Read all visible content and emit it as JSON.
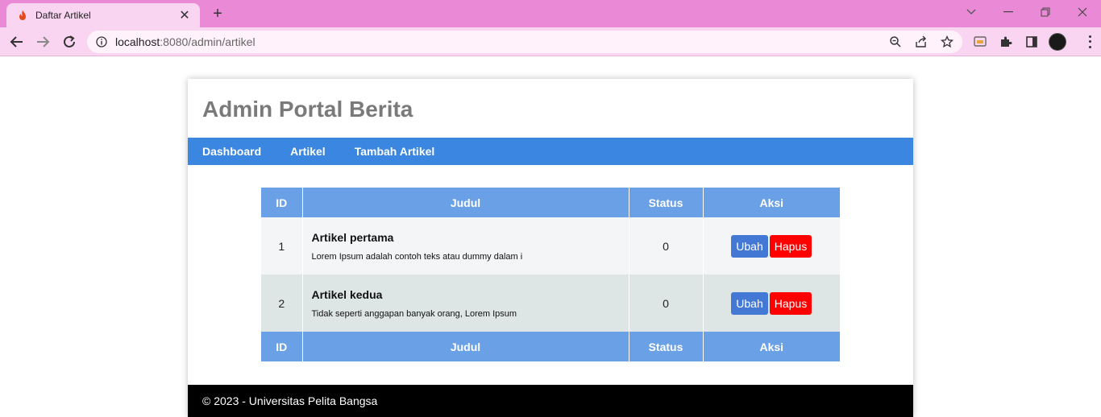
{
  "browser": {
    "tab_title": "Daftar Artikel",
    "tab_close": "✕",
    "new_tab": "+",
    "url_host": "localhost",
    "url_rest": ":8080/admin/artikel"
  },
  "page": {
    "title": "Admin Portal Berita",
    "nav": [
      "Dashboard",
      "Artikel",
      "Tambah Artikel"
    ],
    "table": {
      "headers": [
        "ID",
        "Judul",
        "Status",
        "Aksi"
      ],
      "rows": [
        {
          "id": "1",
          "title": "Artikel pertama",
          "excerpt": "Lorem Ipsum adalah contoh teks atau dummy dalam i",
          "status": "0",
          "edit": "Ubah",
          "delete": "Hapus"
        },
        {
          "id": "2",
          "title": "Artikel kedua",
          "excerpt": "Tidak seperti anggapan banyak orang, Lorem Ipsum",
          "status": "0",
          "edit": "Ubah",
          "delete": "Hapus"
        }
      ],
      "footer_headers": [
        "ID",
        "Judul",
        "Status",
        "Aksi"
      ]
    },
    "footer": "© 2023 - Universitas Pelita Bangsa"
  },
  "colors": {
    "tabbar": "#ea8ad6",
    "nav": "#3a86e0",
    "table_header": "#6aa0e6",
    "edit_button": "#4378d4",
    "delete_button": "#ff0000"
  }
}
